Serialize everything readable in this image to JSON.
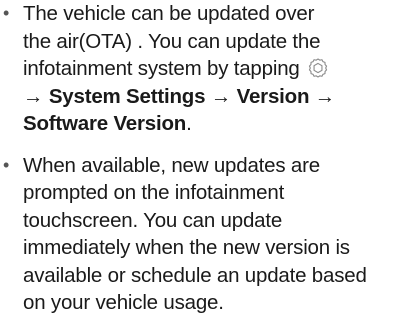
{
  "items": [
    {
      "lines": [
        "The vehicle can be updated over",
        "the air(OTA) . You can update the",
        "infotainment system by tapping"
      ],
      "icon": "settings-gear-icon",
      "path": {
        "arrow": "→",
        "step1": "System Settings",
        "step2": "Version",
        "step3": "Software Version",
        "end": "."
      }
    },
    {
      "lines": [
        "When available, new updates are",
        "prompted on the infotainment",
        "touchscreen. You can update",
        "immediately when the new version is",
        "available or schedule an update based",
        "on your vehicle usage."
      ]
    }
  ],
  "bullet_glyph": "•"
}
